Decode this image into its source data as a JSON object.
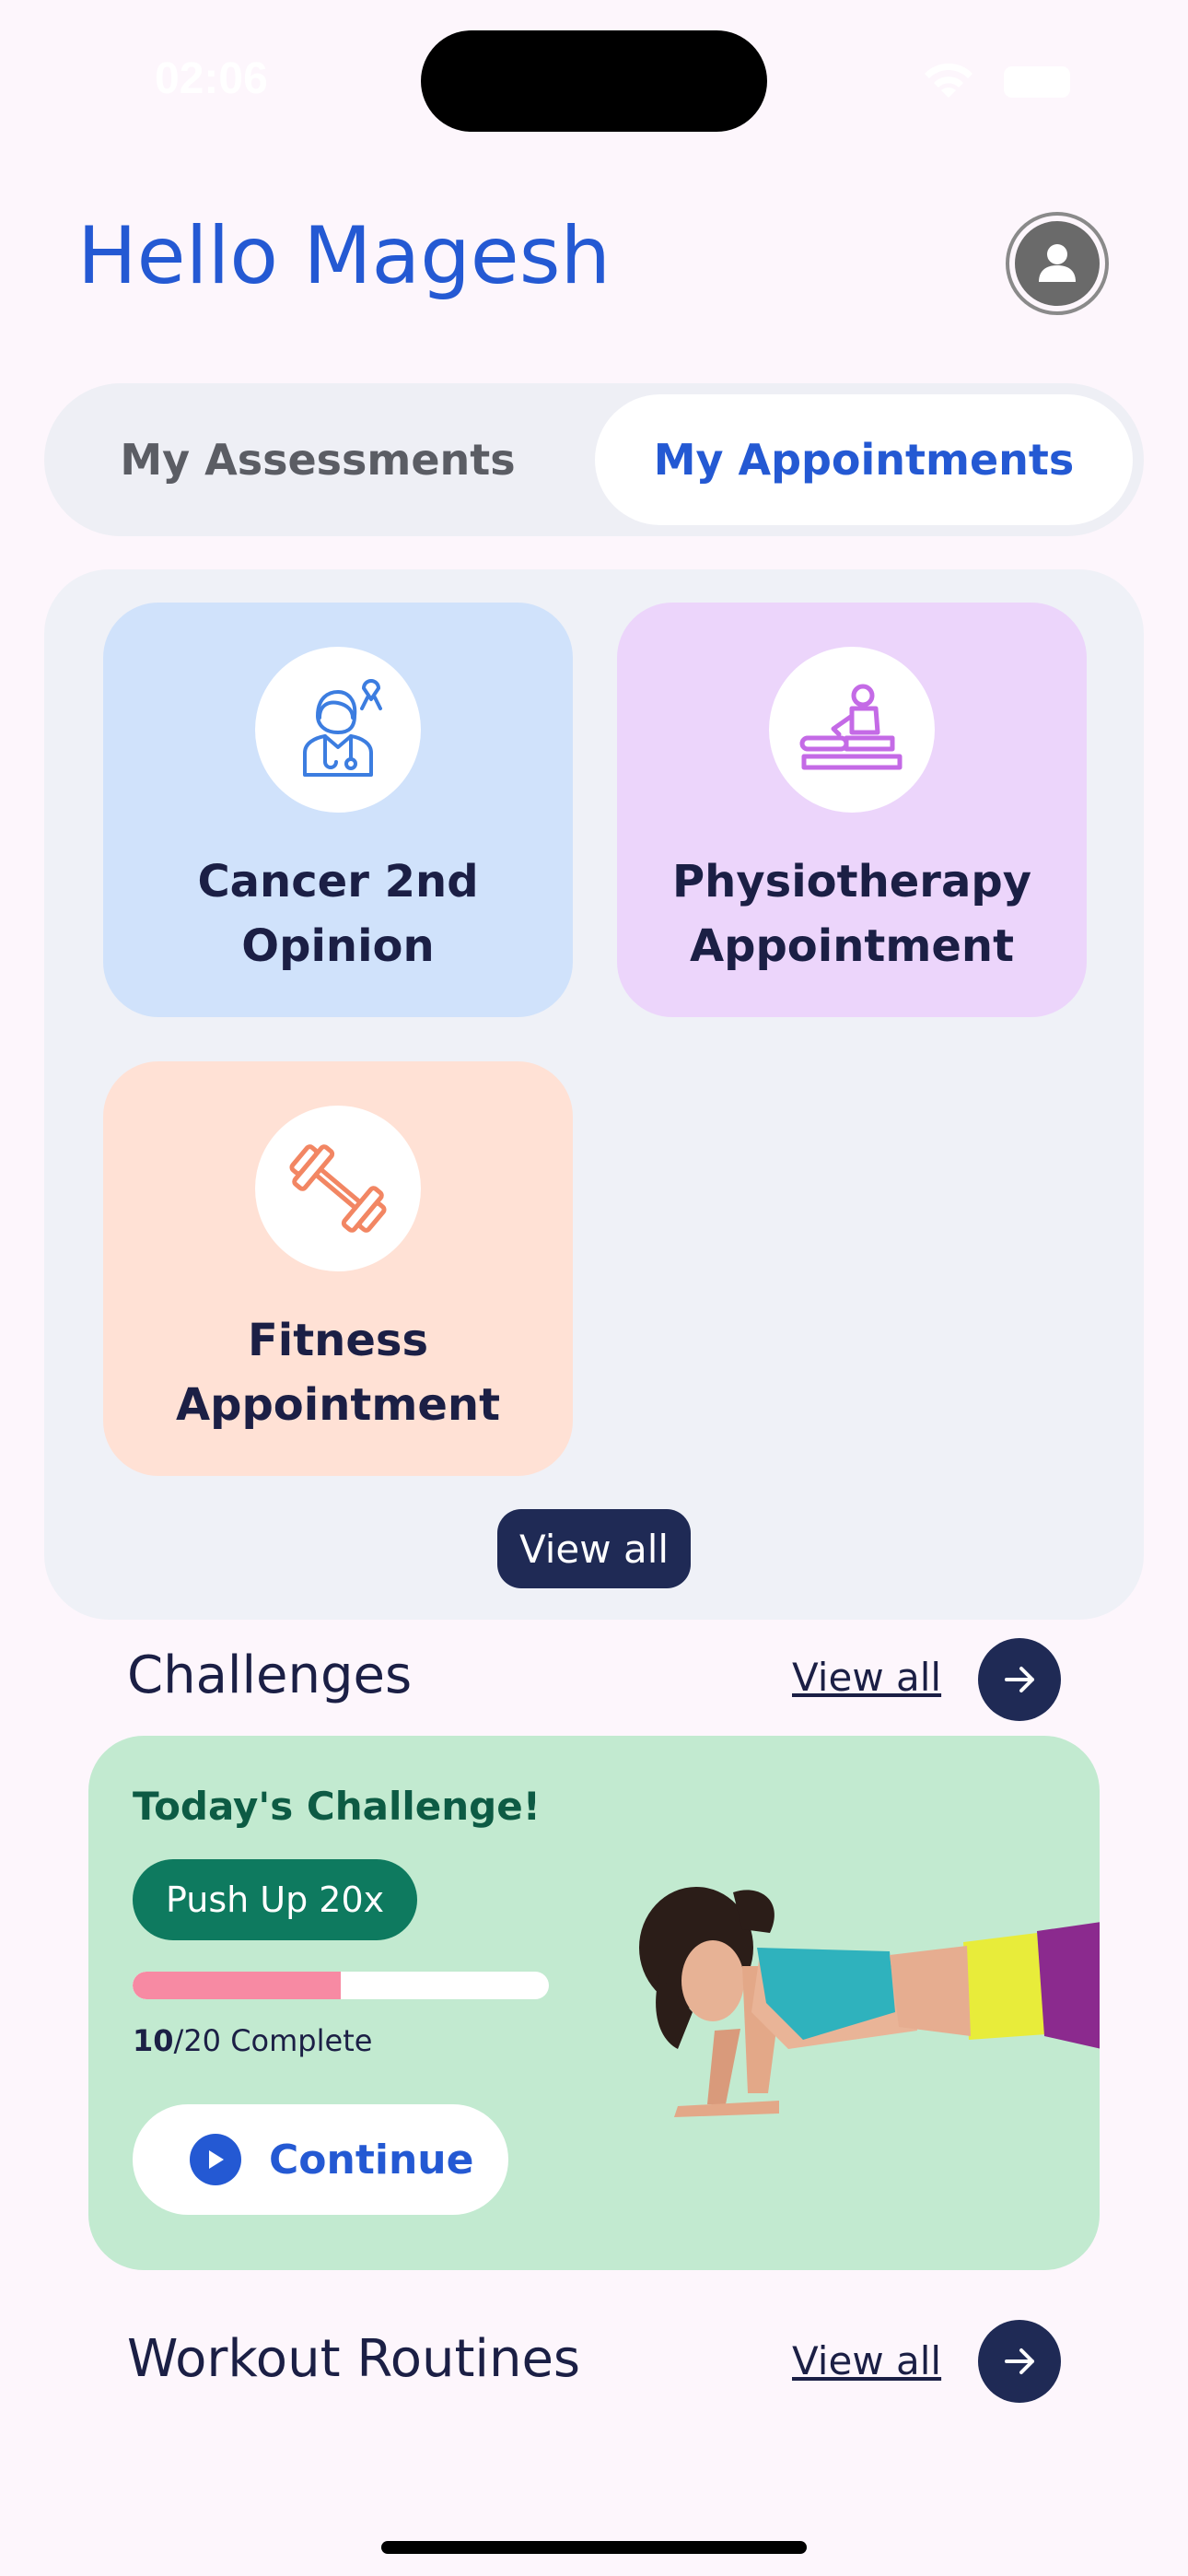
{
  "status_bar": {
    "time": "02:06"
  },
  "header": {
    "greeting": "Hello Magesh"
  },
  "tabs": [
    {
      "label": "My Assessments",
      "selected": false
    },
    {
      "label": "My Appointments",
      "selected": true
    }
  ],
  "services": {
    "cards": [
      {
        "title_line1": "Cancer 2nd",
        "title_line2": "Opinion",
        "icon": "doctor-ribbon-icon",
        "bg": "#d0e2fb",
        "accent": "#3c7de0"
      },
      {
        "title_line1": "Physiotherapy",
        "title_line2": "Appointment",
        "icon": "massage-icon",
        "bg": "#ecd5fb",
        "accent": "#c46ae6"
      },
      {
        "title_line1": "Fitness",
        "title_line2": "Appointment",
        "icon": "dumbbell-icon",
        "bg": "#ffe1d5",
        "accent": "#f28663"
      }
    ],
    "view_all_label": "View all"
  },
  "challenges": {
    "title": "Challenges",
    "view_all_label": "View all",
    "card": {
      "heading": "Today's Challenge!",
      "badge": "Push Up 20x",
      "done": "10",
      "total_text": "/20 Complete",
      "progress": 0.5,
      "continue_label": "Continue"
    }
  },
  "workouts": {
    "title": "Workout Routines",
    "view_all_label": "View all"
  },
  "colors": {
    "primary_blue": "#2459d3",
    "navy": "#1f2a55",
    "challenge_green": "#c2ead0",
    "progress_pink": "#f78aa3"
  }
}
